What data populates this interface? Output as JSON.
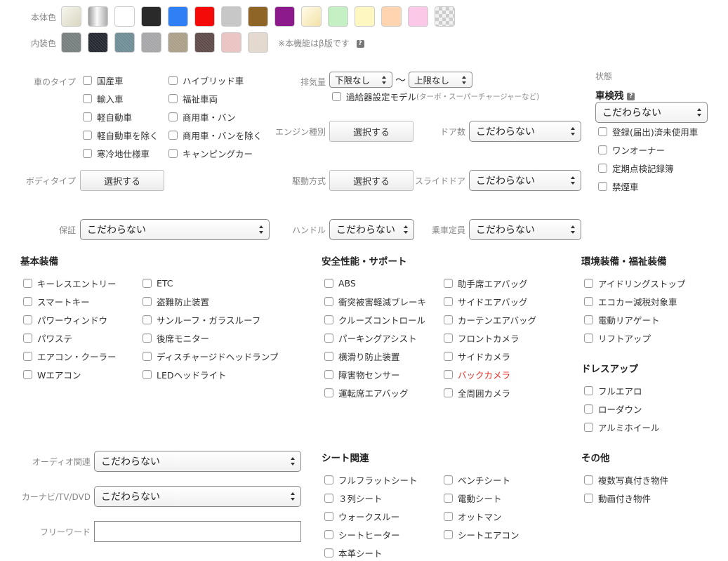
{
  "colors": {
    "body_label": "本体色",
    "interior_label": "内装色",
    "body_swatches": [
      {
        "name": "pearl",
        "color": "#ece9d8"
      },
      {
        "name": "silver",
        "color": "#c8c8c8"
      },
      {
        "name": "white",
        "color": "#ffffff"
      },
      {
        "name": "black",
        "color": "#2a2a2a"
      },
      {
        "name": "blue",
        "color": "#2f7ff5"
      },
      {
        "name": "red",
        "color": "#f50a0a"
      },
      {
        "name": "gray",
        "color": "#c7c7c7"
      },
      {
        "name": "brown",
        "color": "#8f6427"
      },
      {
        "name": "purple",
        "color": "#8c1a8c"
      },
      {
        "name": "gold",
        "color": "#fbf3d2"
      },
      {
        "name": "green",
        "color": "#c4f0c4"
      },
      {
        "name": "yellow",
        "color": "#fff7c2"
      },
      {
        "name": "orange",
        "color": "#ffd4b0"
      },
      {
        "name": "pink",
        "color": "#fcc8e8"
      },
      {
        "name": "other",
        "color": "#dddddd"
      }
    ],
    "interior_swatches": [
      {
        "name": "gray-fabric",
        "color": "#777f7e"
      },
      {
        "name": "black-fabric",
        "color": "#252830"
      },
      {
        "name": "blue-gray-fabric",
        "color": "#6f8d95"
      },
      {
        "name": "light-gray-fabric",
        "color": "#a6a6a8"
      },
      {
        "name": "beige-fabric",
        "color": "#ab9f88"
      },
      {
        "name": "brown-fabric",
        "color": "#5e4b47"
      },
      {
        "name": "pink-fabric",
        "color": "#eac2c2"
      },
      {
        "name": "ivory-fabric",
        "color": "#e2d8cd"
      }
    ],
    "beta_note": "※本機能はβ版です",
    "help": "?"
  },
  "car_type": {
    "label": "車のタイプ",
    "col1": [
      "国産車",
      "輸入車",
      "軽自動車",
      "軽自動車を除く",
      "寒冷地仕様車"
    ],
    "col2": [
      "ハイブリッド車",
      "福祉車両",
      "商用車・バン",
      "商用車・バンを除く",
      "キャンピングカー"
    ]
  },
  "body_type": {
    "label": "ボディタイプ",
    "button": "選択する"
  },
  "displacement": {
    "label": "排気量",
    "min": "下限なし",
    "tilde": "〜",
    "max": "上限なし",
    "turbo": "過給器設定モデル",
    "turbo_note": "(ターボ・スーパーチャージャーなど)"
  },
  "engine": {
    "label": "エンジン種別",
    "button": "選択する"
  },
  "drive": {
    "label": "駆動方式",
    "button": "選択する"
  },
  "doors": {
    "label": "ドア数",
    "value": "こだわらない"
  },
  "slide_door": {
    "label": "スライドドア",
    "value": "こだわらない"
  },
  "status": {
    "label": "状態",
    "inspection_label": "車検残",
    "inspection_value": "こだわらない",
    "options": [
      "登録(届出)済未使用車",
      "ワンオーナー",
      "定期点検記録簿",
      "禁煙車"
    ]
  },
  "warranty": {
    "label": "保証",
    "value": "こだわらない"
  },
  "handle": {
    "label": "ハンドル",
    "value": "こだわらない"
  },
  "capacity": {
    "label": "乗車定員",
    "value": "こだわらない"
  },
  "basic": {
    "title": "基本装備",
    "col1": [
      "キーレスエントリー",
      "スマートキー",
      "パワーウィンドウ",
      "パワステ",
      "エアコン・クーラー",
      "Wエアコン"
    ],
    "col2": [
      "ETC",
      "盗難防止装置",
      "サンルーフ・ガラスルーフ",
      "後席モニター",
      "ディスチャージドヘッドランプ",
      "LEDヘッドライト"
    ]
  },
  "safety": {
    "title": "安全性能・サポート",
    "col1": [
      "ABS",
      "衝突被害軽減ブレーキ",
      "クルーズコントロール",
      "パーキングアシスト",
      "横滑り防止装置",
      "障害物センサー",
      "運転席エアバッグ"
    ],
    "col2": [
      "助手席エアバッグ",
      "サイドエアバッグ",
      "カーテンエアバッグ",
      "フロントカメラ",
      "サイドカメラ",
      "バックカメラ",
      "全周囲カメラ"
    ]
  },
  "eco": {
    "title": "環境装備・福祉装備",
    "items": [
      "アイドリングストップ",
      "エコカー減税対象車",
      "電動リアゲート",
      "リフトアップ"
    ]
  },
  "dressup": {
    "title": "ドレスアップ",
    "items": [
      "フルエアロ",
      "ローダウン",
      "アルミホイール"
    ]
  },
  "audio": {
    "label": "オーディオ関連",
    "value": "こだわらない"
  },
  "navi": {
    "label": "カーナビ/TV/DVD",
    "value": "こだわらない"
  },
  "freeword": {
    "label": "フリーワード",
    "value": ""
  },
  "seat": {
    "title": "シート関連",
    "col1": [
      "フルフラットシート",
      "３列シート",
      "ウォークスルー",
      "シートヒーター",
      "本革シート"
    ],
    "col2": [
      "ベンチシート",
      "電動シート",
      "オットマン",
      "シートエアコン"
    ]
  },
  "other": {
    "title": "その他",
    "items": [
      "複数写真付き物件",
      "動画付き物件"
    ]
  },
  "accent_red": "#e8332a"
}
